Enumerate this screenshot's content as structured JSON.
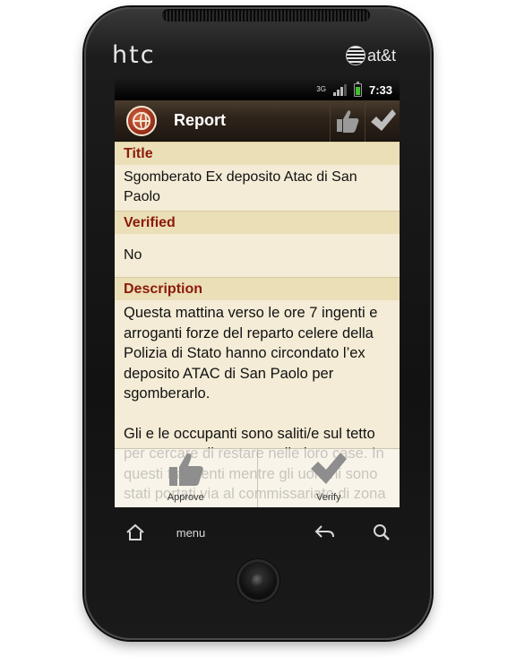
{
  "device": {
    "brand": "htc",
    "carrier": "at&t"
  },
  "statusbar": {
    "network": "3G",
    "time": "7:33",
    "battery_color": "#3fbf2f"
  },
  "titlebar": {
    "title": "Report",
    "approve_icon": "thumbs-up-icon",
    "verify_icon": "checkmark-icon"
  },
  "sections": {
    "title_heading": "Title",
    "title_value": "Sgomberato Ex deposito Atac di San Paolo",
    "verified_heading": "Verified",
    "verified_value": "No",
    "description_heading": "Description",
    "description_p1": "Questa mattina verso le ore 7 ingenti e arroganti forze del reparto celere della Polizia di Stato hanno circondato l’ex deposito ATAC di San Paolo per sgomberarlo.",
    "description_p2": "Gli e le occupanti sono saliti/e sul tetto per cercare di restare nelle loro case. In questi frangenti mentre gli uomini sono stati portati via al commissariato di zona e ora sono stati rilasciati gli occupanti della"
  },
  "actions": {
    "approve_label": "Approve",
    "verify_label": "Verify"
  },
  "navkeys": {
    "menu_label": "menu"
  },
  "colors": {
    "heading_text": "#8b1a0a",
    "heading_bg": "#ebdfb8",
    "content_bg": "#f4ecd6",
    "titlebar_bg": "#2d231a"
  }
}
